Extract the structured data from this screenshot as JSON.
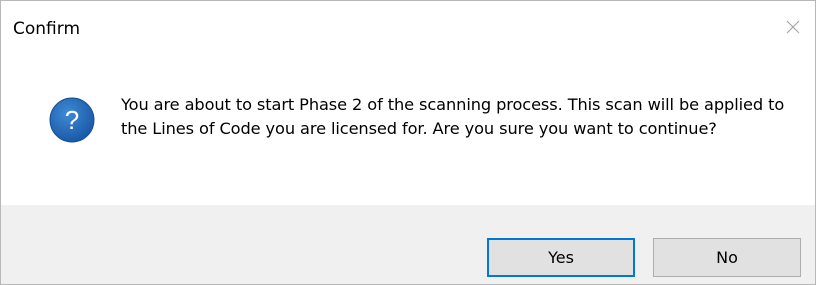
{
  "window": {
    "title": "Confirm",
    "close_icon": "close-icon"
  },
  "content": {
    "icon": "question-icon",
    "icon_symbol": "?",
    "icon_color": "#1f64b4",
    "message": "You are about to start Phase 2 of the scanning process. This scan will be applied to the Lines of Code you are licensed for. Are you sure you want to continue?"
  },
  "buttons": {
    "yes_label": "Yes",
    "no_label": "No",
    "default": "yes",
    "default_border_color": "#0078d7"
  },
  "colors": {
    "footer_background": "#f0f0f0",
    "button_background": "#e1e1e1"
  }
}
